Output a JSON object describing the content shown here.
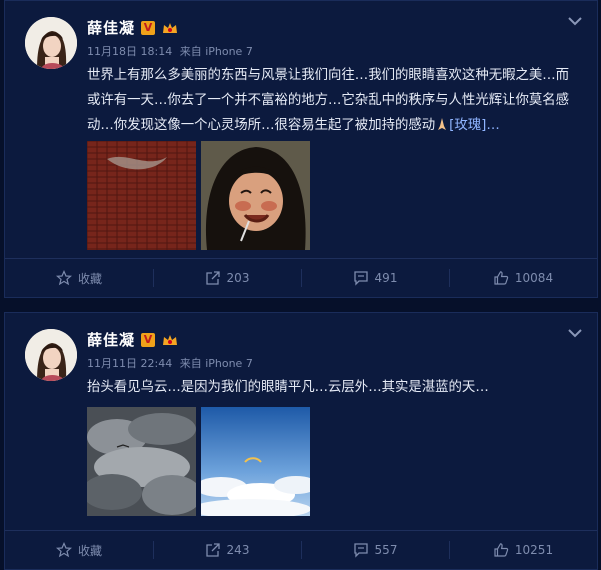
{
  "posts": [
    {
      "username": "薛佳凝",
      "verified_badge": "V",
      "date": "11月18日 18:14",
      "source": "来自 iPhone 7",
      "text": "世界上有那么多美丽的东西与风景让我们向往…我们的眼睛喜欢这种无暇之美…而或许有一天…你去了一个并不富裕的地方…它杂乱中的秩序与人性光辉让你莫名感动…你发现这像一个心灵场所…很容易生起了被加持的感动",
      "emoji_tail": "[玫瑰]…",
      "images": [
        "red-wall-photo",
        "smiling-child-photo"
      ],
      "actions": {
        "favorite": "收藏",
        "repost": "203",
        "comment": "491",
        "like": "10084"
      }
    },
    {
      "username": "薛佳凝",
      "verified_badge": "V",
      "date": "11月11日 22:44",
      "source": "来自 iPhone 7",
      "text": "抬头看见乌云…是因为我们的眼睛平凡…云层外…其实是湛蓝的天…",
      "images": [
        "dark-clouds-photo",
        "blue-sky-clouds-photo"
      ],
      "actions": {
        "favorite": "收藏",
        "repost": "243",
        "comment": "557",
        "like": "10251"
      }
    }
  ],
  "colors": {
    "background": "#06102a",
    "card": "#0c1a3e",
    "text": "#e6ebf6",
    "meta": "#7e8cae",
    "link": "#8fb4ff"
  }
}
